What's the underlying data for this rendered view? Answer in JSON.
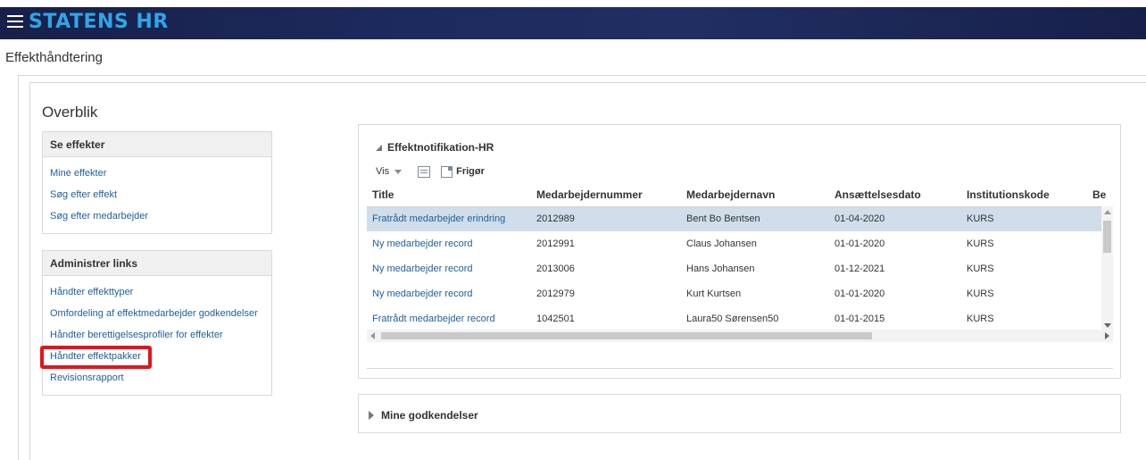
{
  "header": {
    "brand": "STATENS HR"
  },
  "page": {
    "title": "Effekthåndtering"
  },
  "overview": {
    "title": "Overblik"
  },
  "se_effekter": {
    "title": "Se effekter",
    "links": [
      "Mine effekter",
      "Søg efter effekt",
      "Søg efter medarbejder"
    ]
  },
  "administrer": {
    "title": "Administrer links",
    "links": [
      "Håndter effekttyper",
      "Omfordeling af effektmedarbejder godkendelser",
      "Håndter berettigelsesprofiler for effekter",
      "Håndter effektpakker",
      "Revisionsrapport"
    ],
    "highlighted_index": 3,
    "highlight_color": "#e3141b"
  },
  "notifications": {
    "title": "Effektnotifikation-HR",
    "toolbar": {
      "view_label": "Vis",
      "release_label": "Frigør"
    },
    "columns": [
      "Title",
      "Medarbejdernummer",
      "Medarbejdernavn",
      "Ansættelsesdato",
      "Institutionskode",
      "Be"
    ],
    "rows": [
      {
        "title": "Fratrådt medarbejder erindring",
        "number": "2012989",
        "name": "Bent Bo Bentsen",
        "date": "01-04-2020",
        "inst": "KURS",
        "selected": true
      },
      {
        "title": "Ny medarbejder record",
        "number": "2012991",
        "name": "Claus Johansen",
        "date": "01-01-2020",
        "inst": "KURS",
        "selected": false
      },
      {
        "title": "Ny medarbejder record",
        "number": "2013006",
        "name": "Hans Johansen",
        "date": "01-12-2021",
        "inst": "KURS",
        "selected": false
      },
      {
        "title": "Ny medarbejder record",
        "number": "2012979",
        "name": "Kurt Kurtsen",
        "date": "01-01-2020",
        "inst": "KURS",
        "selected": false
      },
      {
        "title": "Fratrådt medarbejder record",
        "number": "1042501",
        "name": "Laura50 Sørensen50",
        "date": "01-01-2015",
        "inst": "KURS",
        "selected": false
      }
    ]
  },
  "approvals": {
    "title": "Mine godkendelser"
  },
  "colors": {
    "brand_bar": "#1c2a5c",
    "brand_text": "#2ea6e6",
    "link": "#1f5f99",
    "selected_row": "#cfdeea"
  }
}
